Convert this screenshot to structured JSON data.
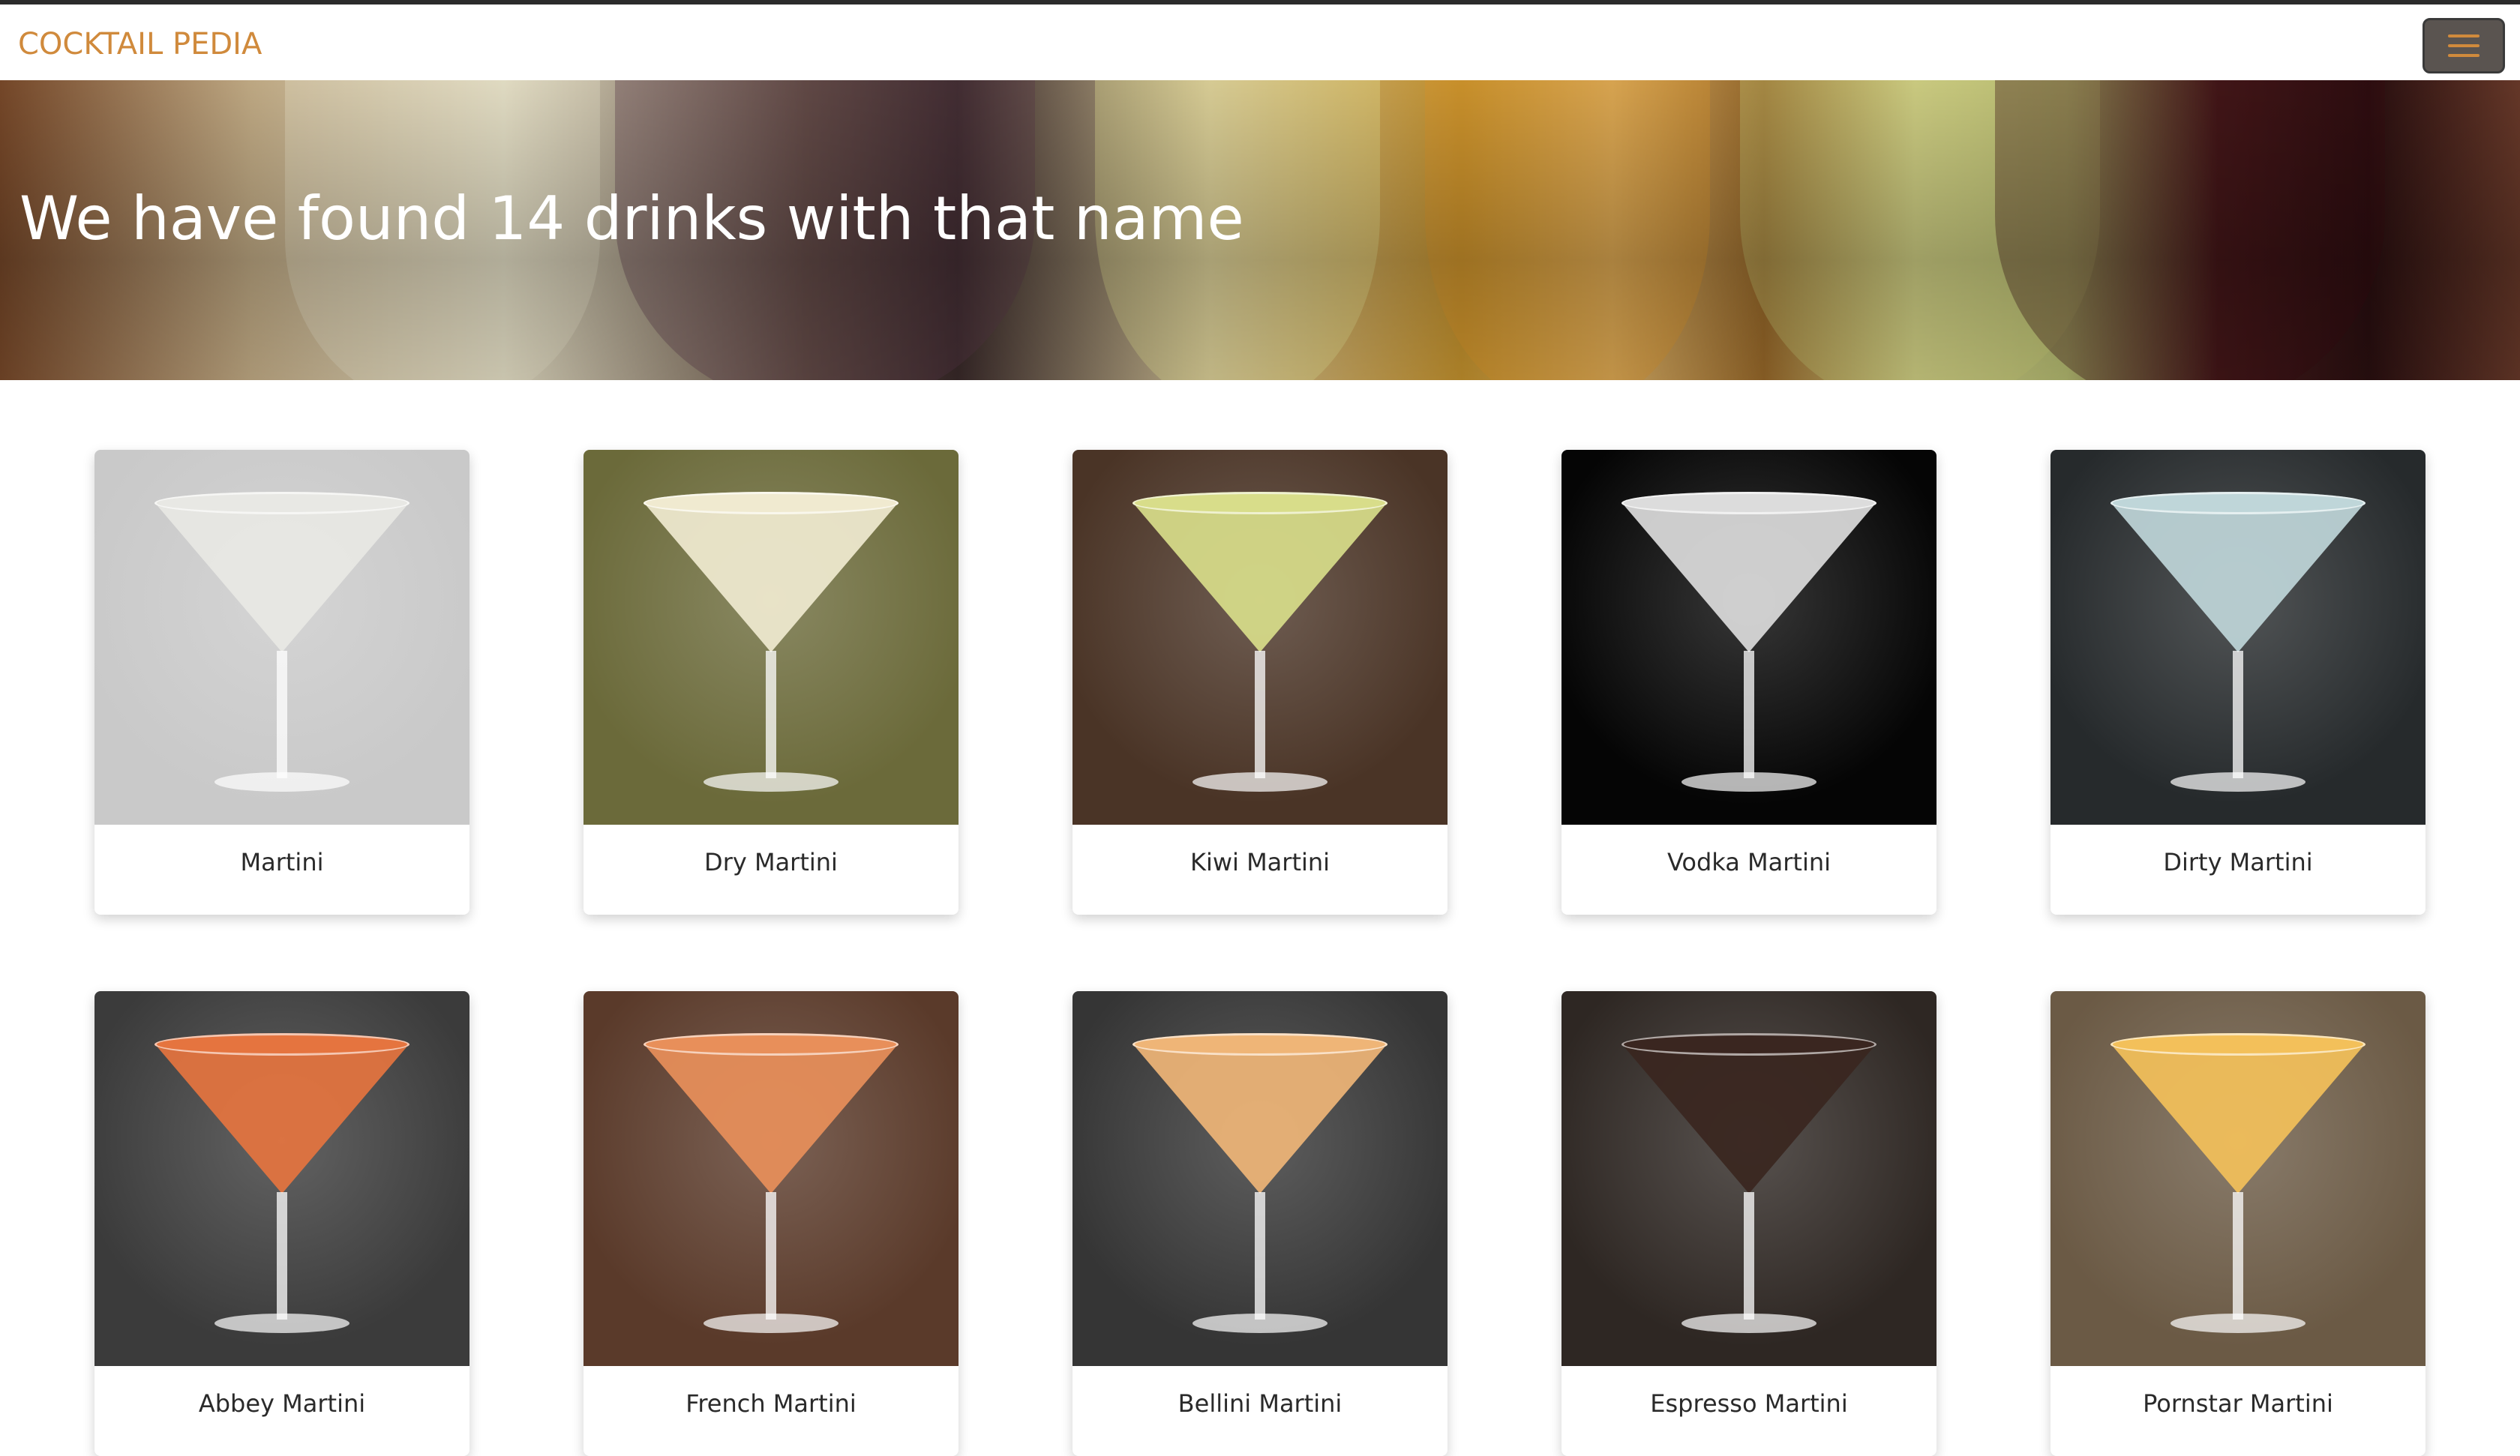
{
  "navbar": {
    "brand": "COCKTAIL PEDIA",
    "menu_icon": "hamburger-menu-icon"
  },
  "hero": {
    "title": "We have found 14 drinks with that name"
  },
  "drinks": [
    {
      "name": "Martini",
      "bg": "#c9c9c9",
      "liquid": "#e8e8e4"
    },
    {
      "name": "Dry Martini",
      "bg": "#6b6a3a",
      "liquid": "#f0ead0"
    },
    {
      "name": "Kiwi Martini",
      "bg": "#4a3426",
      "liquid": "#d8dd8a"
    },
    {
      "name": "Vodka Martini",
      "bg": "#050505",
      "liquid": "#dcdcdc"
    },
    {
      "name": "Dirty Martini",
      "bg": "#262a2c",
      "liquid": "#bfd6d9"
    },
    {
      "name": "Abbey Martini",
      "bg": "#3b3b3b",
      "liquid": "#e5743f"
    },
    {
      "name": "French Martini",
      "bg": "#5a3a2a",
      "liquid": "#e88f5a"
    },
    {
      "name": "Bellini Martini",
      "bg": "#353535",
      "liquid": "#efb577"
    },
    {
      "name": "Espresso Martini",
      "bg": "#2e2723",
      "liquid": "#3a2620"
    },
    {
      "name": "Pornstar Martini",
      "bg": "#6b5a45",
      "liquid": "#f3c05a"
    }
  ]
}
